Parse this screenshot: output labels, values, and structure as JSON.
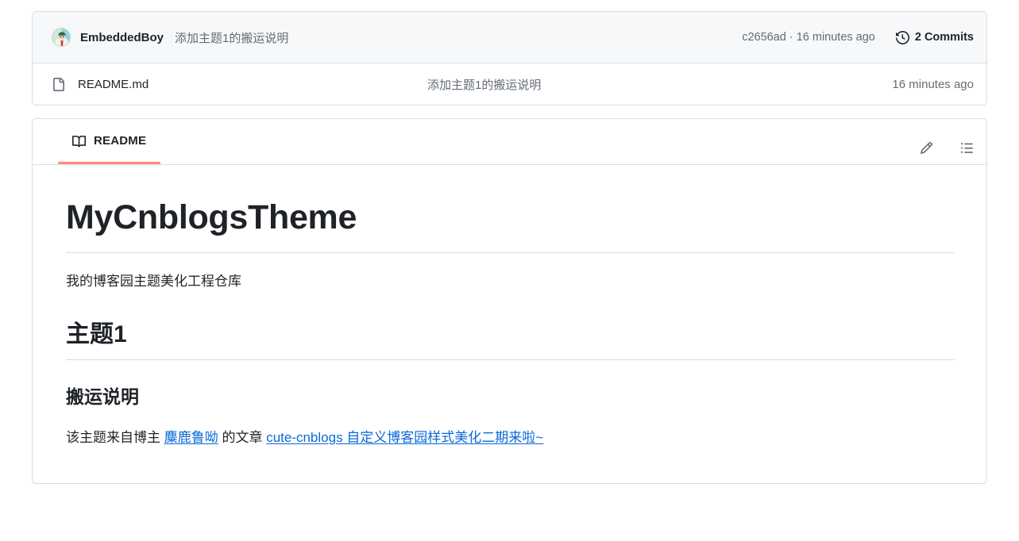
{
  "commit_card": {
    "author": "EmbeddedBoy",
    "avatar_alt": "user-avatar",
    "commit_message": "添加主题1的搬运说明",
    "commit_meta": "c2656ad · 16 minutes ago",
    "commits_label": "2 Commits",
    "history_icon": "history-icon"
  },
  "file_row": {
    "file_icon": "file-icon",
    "name": "README.md",
    "commit_message": "添加主题1的搬运说明",
    "time": "16 minutes ago"
  },
  "readme": {
    "tab_label": "README",
    "book_icon": "book-icon",
    "edit_icon": "pencil-icon",
    "outline_icon": "list-unordered-icon",
    "h1": "MyCnblogsTheme",
    "intro": "我的博客园主题美化工程仓库",
    "h2": "主题1",
    "h3": "搬运说明",
    "para_prefix": "该主题来自博主 ",
    "author_link": "麋鹿鲁呦",
    "para_middle": " 的文章 ",
    "article_link": "cute-cnblogs 自定义博客园样式美化二期来啦~"
  },
  "colors": {
    "accent_tab": "#fd8c73",
    "link": "#0969da",
    "border": "#d8dee4",
    "muted_text": "#636c76",
    "text": "#1f2328",
    "header_bg": "#f6f8fa"
  }
}
